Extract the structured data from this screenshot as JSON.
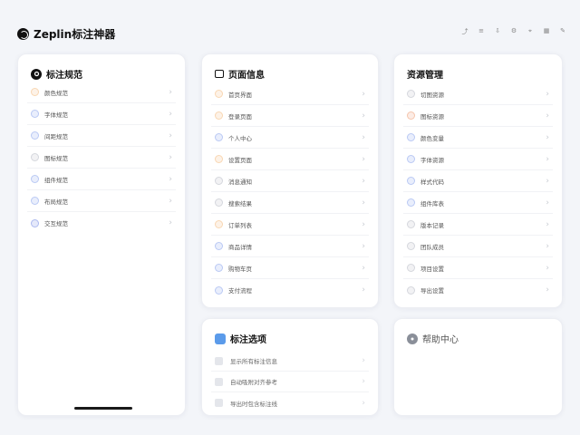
{
  "app": {
    "title": "Zeplin标注神器"
  },
  "header_actions": [
    {
      "icon": "share-icon",
      "glyph": "⤴"
    },
    {
      "icon": "layers-icon",
      "glyph": "≡"
    },
    {
      "icon": "download-icon",
      "glyph": "⇩"
    },
    {
      "icon": "settings-icon",
      "glyph": "⚙"
    },
    {
      "icon": "inspect-icon",
      "glyph": "⌖"
    },
    {
      "icon": "grid-icon",
      "glyph": "▦"
    },
    {
      "icon": "edit-icon",
      "glyph": "✎"
    }
  ],
  "left_panel": {
    "title": "标注规范",
    "items": [
      {
        "label": "颜色规范",
        "color": "#f0a04b"
      },
      {
        "label": "字体规范",
        "color": "#5b7ee5"
      },
      {
        "label": "间距规范",
        "color": "#5b7ee5"
      },
      {
        "label": "图标规范",
        "color": "#9aa0ad"
      },
      {
        "label": "组件规范",
        "color": "#5b7ee5"
      },
      {
        "label": "布局规范",
        "color": "#5b7ee5"
      },
      {
        "label": "交互规范",
        "color": "#3d5bd9"
      }
    ]
  },
  "middle_panel": {
    "title": "页面信息",
    "items": [
      {
        "label": "首页界面",
        "color": "#f0a04b"
      },
      {
        "label": "登录页面",
        "color": "#f0a04b"
      },
      {
        "label": "个人中心",
        "color": "#5b7ee5"
      },
      {
        "label": "设置页面",
        "color": "#f0a04b"
      },
      {
        "label": "消息通知",
        "color": "#9aa0ad"
      },
      {
        "label": "搜索结果",
        "color": "#9aa0ad"
      },
      {
        "label": "订单列表",
        "color": "#f0a04b"
      },
      {
        "label": "商品详情",
        "color": "#5b7ee5"
      },
      {
        "label": "购物车页",
        "color": "#5b7ee5"
      },
      {
        "label": "支付流程",
        "color": "#5b7ee5"
      }
    ]
  },
  "right_panel": {
    "title": "资源管理",
    "items": [
      {
        "label": "切图资源",
        "color": "#9aa0ad"
      },
      {
        "label": "图标资源",
        "color": "#e8743b"
      },
      {
        "label": "颜色变量",
        "color": "#5b7ee5"
      },
      {
        "label": "字体资源",
        "color": "#5b7ee5"
      },
      {
        "label": "样式代码",
        "color": "#5b7ee5"
      },
      {
        "label": "组件库表",
        "color": "#5b7ee5"
      },
      {
        "label": "版本记录",
        "color": "#9aa0ad"
      },
      {
        "label": "团队成员",
        "color": "#9aa0ad"
      },
      {
        "label": "项目设置",
        "color": "#9aa0ad"
      },
      {
        "label": "导出设置",
        "color": "#9aa0ad"
      }
    ]
  },
  "bottom_middle": {
    "title": "标注选项",
    "options": [
      {
        "label": "显示所有标注信息"
      },
      {
        "label": "自动吸附对齐参考"
      },
      {
        "label": "导出时包含标注线"
      }
    ]
  },
  "bottom_right": {
    "title": "帮助中心"
  }
}
